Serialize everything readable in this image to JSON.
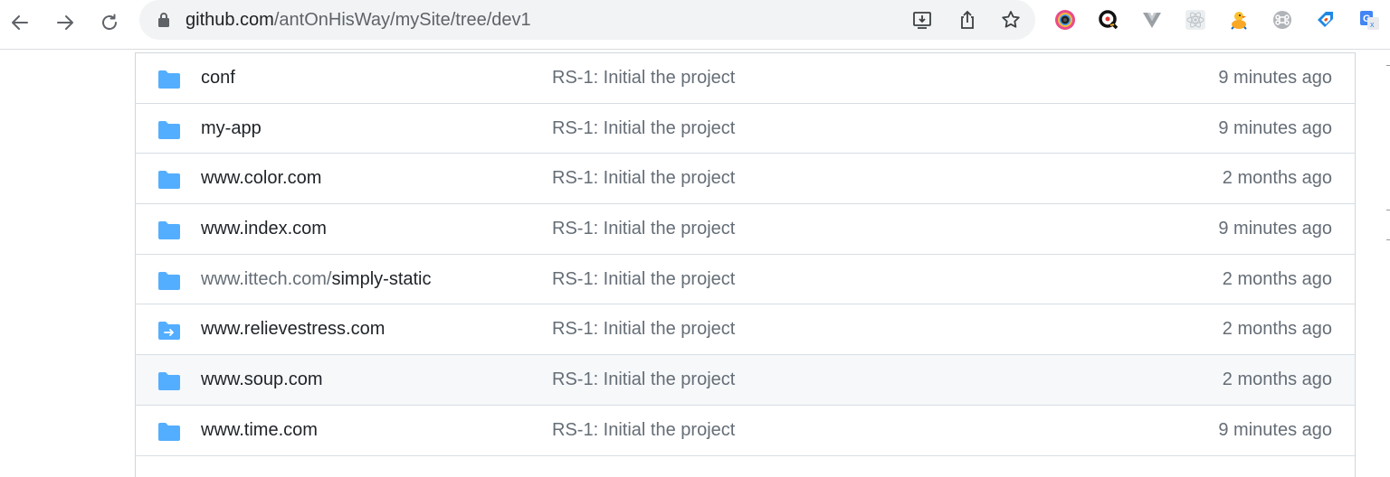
{
  "browser": {
    "url_host": "github.com",
    "url_path": "/antOnHisWay/mySite/tree/dev1",
    "nav": [
      "back-icon",
      "forward-icon",
      "reload-icon"
    ],
    "omnibox_actions": [
      "install-icon",
      "share-icon",
      "bookmark-star-icon"
    ],
    "extensions": [
      "camera-extension-icon",
      "q-extension-icon",
      "vue-devtools-icon",
      "react-devtools-icon",
      "duck-extension-icon",
      "command-extension-icon",
      "tag-extension-icon",
      "translate-extension-icon"
    ]
  },
  "files": [
    {
      "name_prefix": "",
      "name": "conf",
      "type": "folder",
      "message": "RS-1: Initial the project",
      "time": "9 minutes ago"
    },
    {
      "name_prefix": "",
      "name": "my-app",
      "type": "folder",
      "message": "RS-1: Initial the project",
      "time": "9 minutes ago"
    },
    {
      "name_prefix": "",
      "name": "www.color.com",
      "type": "folder",
      "message": "RS-1: Initial the project",
      "time": "2 months ago"
    },
    {
      "name_prefix": "",
      "name": "www.index.com",
      "type": "folder",
      "message": "RS-1: Initial the project",
      "time": "9 minutes ago"
    },
    {
      "name_prefix": "www.ittech.com/",
      "name": "simply-static",
      "type": "folder",
      "message": "RS-1: Initial the project",
      "time": "2 months ago"
    },
    {
      "name_prefix": "",
      "name": "www.relievestress.com",
      "type": "symlink-folder",
      "message": "RS-1: Initial the project",
      "time": "2 months ago"
    },
    {
      "name_prefix": "",
      "name": "www.soup.com",
      "type": "folder",
      "message": "RS-1: Initial the project",
      "time": "2 months ago"
    },
    {
      "name_prefix": "",
      "name": "www.time.com",
      "type": "folder",
      "message": "RS-1: Initial the project",
      "time": "9 minutes ago"
    }
  ],
  "colors": {
    "folder": "#54aeff",
    "text_primary": "#1f2328",
    "text_muted": "#656d76",
    "row_hover": "#f6f8fa"
  }
}
